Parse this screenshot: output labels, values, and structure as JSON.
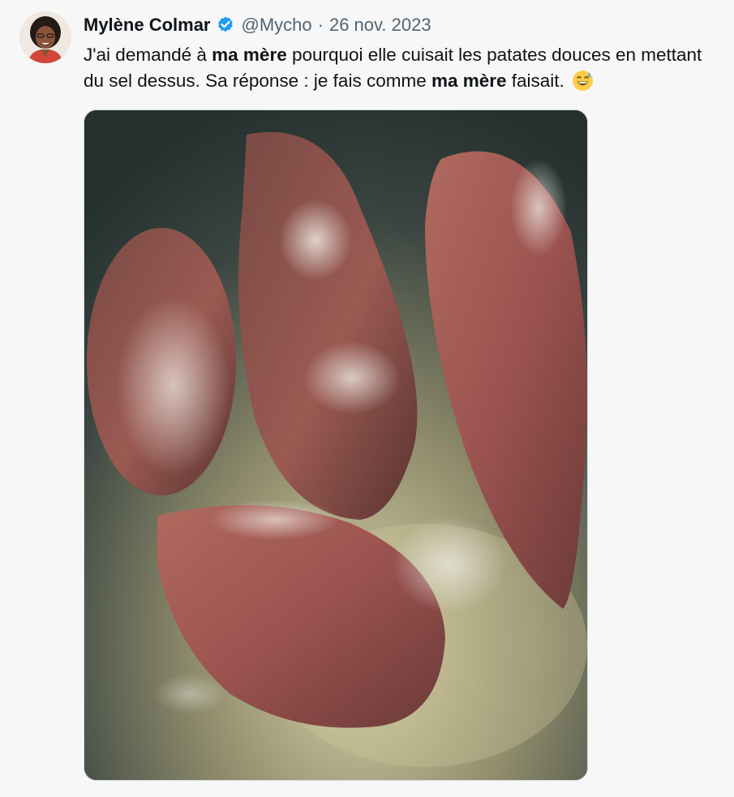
{
  "tweet": {
    "author_name": "Mylène Colmar",
    "handle": "@Mycho",
    "separator": "·",
    "date": "26 nov. 2023",
    "text_parts": {
      "p1": "J'ai demandé à ",
      "b1": "ma mère",
      "p2": " pourquoi elle cuisait les patates douces en mettant du sel dessus. Sa réponse : je fais comme ",
      "b2": "ma mère",
      "p3": " faisait."
    },
    "emoji": "grinning-face-with-sweat",
    "verified_icon": "verified-badge-icon"
  },
  "colors": {
    "verified_blue": "#1d9bf0",
    "text": "#0f1419",
    "secondary": "#536471",
    "background": "#f7f7f7"
  }
}
